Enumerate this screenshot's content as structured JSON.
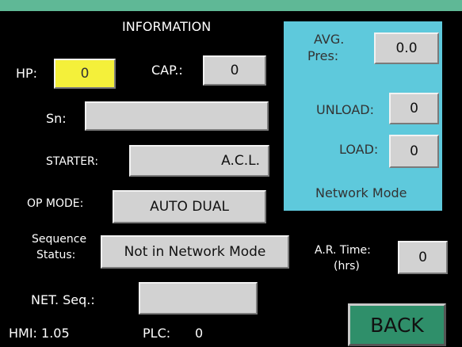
{
  "header": {
    "title": "INFORMATION"
  },
  "fields": {
    "hp": {
      "label": "HP:",
      "value": "0"
    },
    "cap": {
      "label": "CAP.:",
      "value": "0"
    },
    "sn": {
      "label": "Sn:",
      "value": ""
    },
    "starter": {
      "label": "STARTER:",
      "value": "A.C.L."
    },
    "op_mode": {
      "label": "OP MODE:",
      "value": "AUTO DUAL"
    },
    "sequence_status": {
      "label_line1": "Sequence",
      "label_line2": "Status:",
      "value": "Not in Network Mode"
    },
    "net_seq": {
      "label": "NET. Seq.:",
      "value": ""
    }
  },
  "network_panel": {
    "avg_pres_line1": "AVG.",
    "avg_pres_line2": "Pres:",
    "avg_pres_value": "0.0",
    "unload_label": "UNLOAD:",
    "unload_value": "0",
    "load_label": "LOAD:",
    "load_value": "0",
    "mode_label": "Network Mode"
  },
  "ar_time": {
    "label_line1": "A.R. Time:",
    "label_line2": "(hrs)",
    "value": "0"
  },
  "footer": {
    "hmi": "HMI: 1.05",
    "plc_label": "PLC:",
    "plc_value": "0"
  },
  "buttons": {
    "back": "BACK"
  },
  "colors": {
    "background": "#000000",
    "top_bar": "#5fb896",
    "panel": "#5ec9dc",
    "highlight": "#f4f03a",
    "back_button": "#2f8f6a"
  }
}
